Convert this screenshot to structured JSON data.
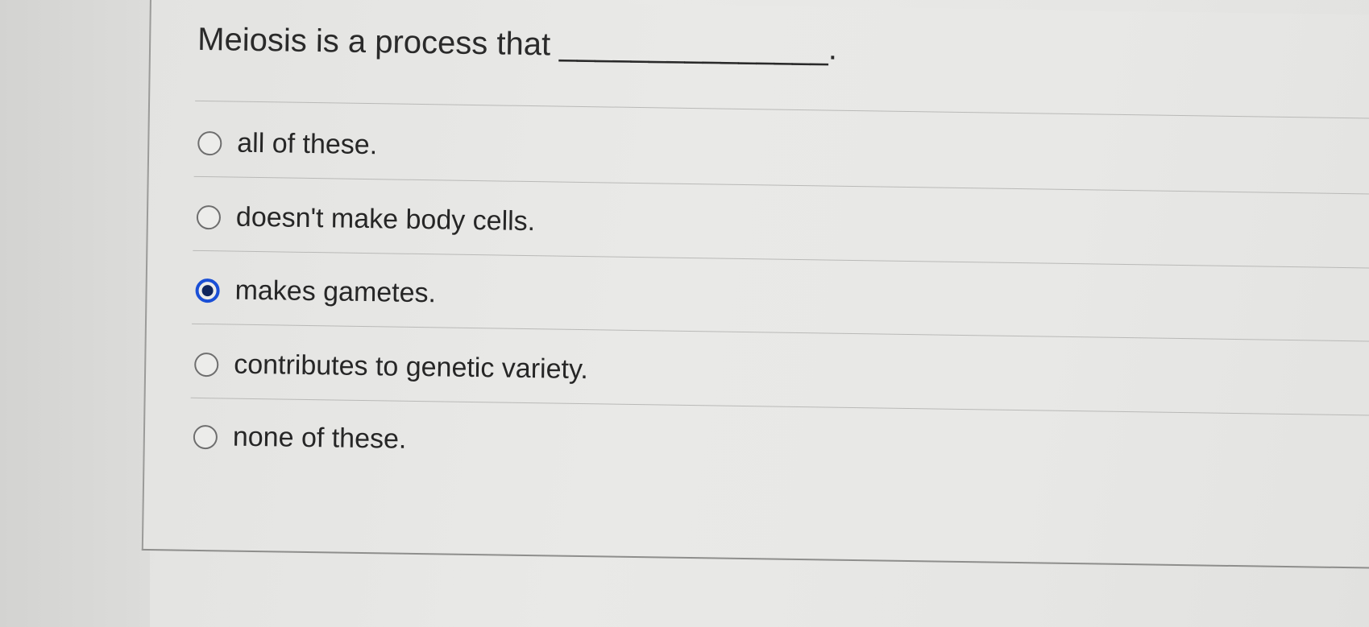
{
  "question": {
    "text": "Meiosis is a process that _______________."
  },
  "options": [
    {
      "label": "all of these.",
      "selected": false
    },
    {
      "label": "doesn't make body cells.",
      "selected": false
    },
    {
      "label": "makes gametes.",
      "selected": true
    },
    {
      "label": "contributes to genetic variety.",
      "selected": false
    },
    {
      "label": "none of these.",
      "selected": false
    }
  ],
  "colors": {
    "selected_radio": "#1a4fd6",
    "text": "#262626",
    "background": "#e8e8e6"
  }
}
